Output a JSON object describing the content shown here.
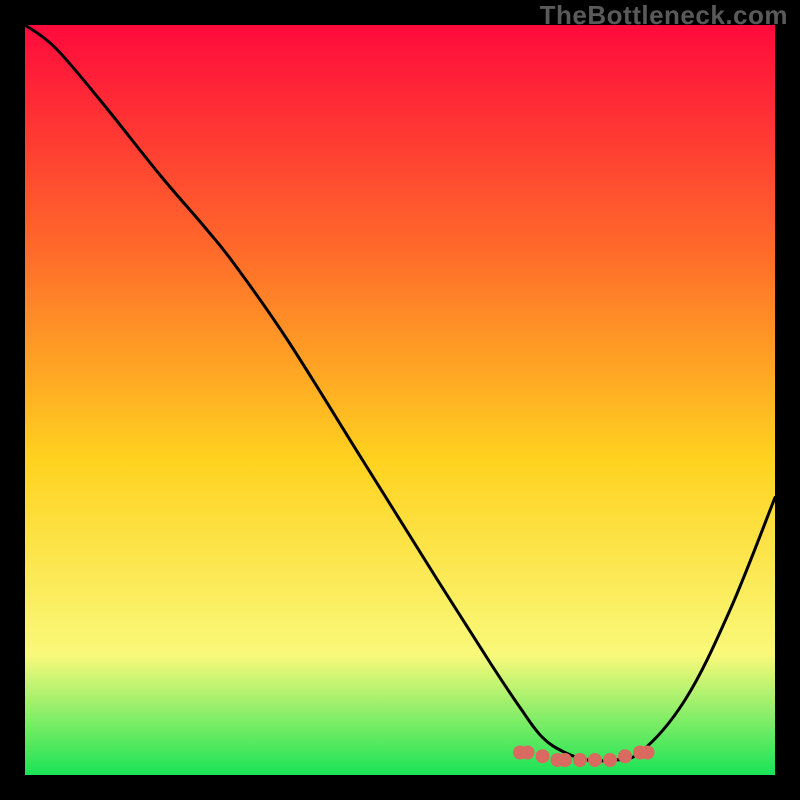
{
  "watermark": "TheBottleneck.com",
  "colors": {
    "background": "#000000",
    "watermark": "#5a5a5a",
    "gradient_top": "#ff0a3c",
    "gradient_mid_upper": "#ff6a2a",
    "gradient_mid": "#ffd21f",
    "gradient_mid_lower": "#f9f97a",
    "gradient_bottom": "#19e356",
    "curve": "#000000",
    "marker": "#d86a60"
  },
  "chart_data": {
    "type": "line",
    "title": "",
    "xlabel": "",
    "ylabel": "",
    "xlim": [
      0,
      100
    ],
    "ylim": [
      0,
      100
    ],
    "grid": false,
    "series": [
      {
        "name": "bottleneck-curve",
        "x": [
          0,
          4,
          10,
          18,
          24,
          28,
          35,
          45,
          55,
          62,
          66,
          69,
          72,
          75,
          78,
          82,
          88,
          94,
          100
        ],
        "y": [
          100,
          97,
          90,
          80,
          73,
          68,
          58,
          42,
          26,
          15,
          9,
          5,
          3,
          2,
          2,
          3,
          10,
          22,
          37
        ]
      }
    ],
    "markers": {
      "name": "optimal-zone",
      "x": [
        66,
        67,
        69,
        71,
        72,
        74,
        76,
        78,
        80,
        82,
        83
      ],
      "y": [
        3,
        3,
        2.5,
        2,
        2,
        2,
        2,
        2,
        2.5,
        3,
        3
      ]
    }
  }
}
